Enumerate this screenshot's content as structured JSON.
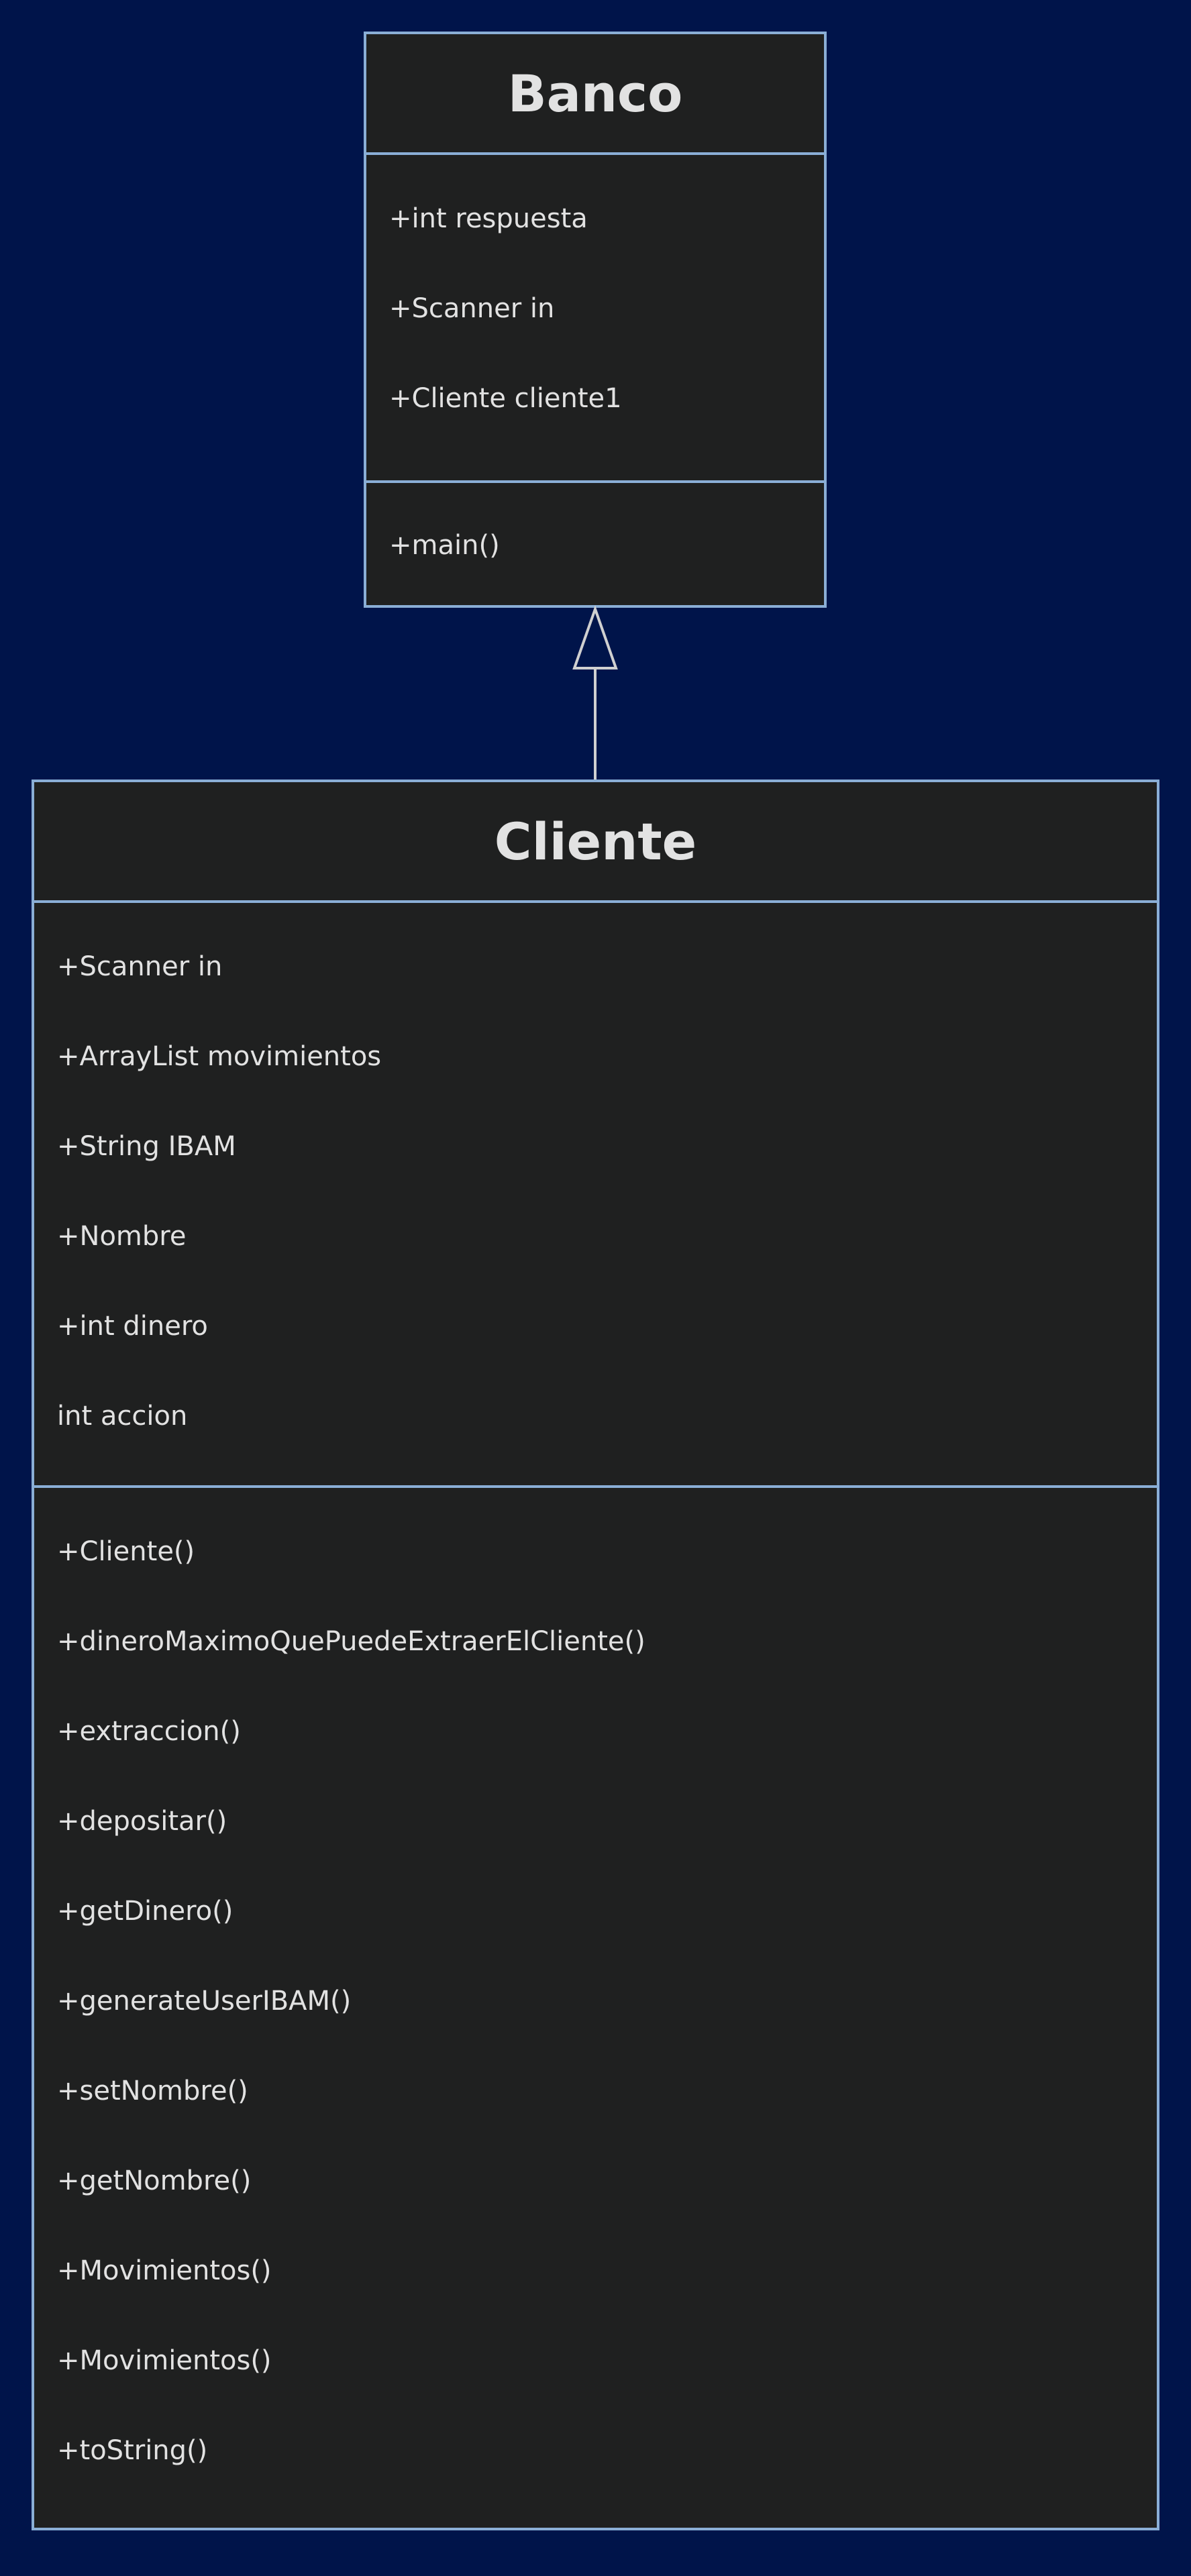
{
  "diagram": {
    "colors": {
      "background": "#00144a",
      "class_fill": "#1f2020",
      "class_border": "#8aaed6",
      "text": "#e2e2e2",
      "relation_line": "#d0d0d0"
    },
    "classes": [
      {
        "id": "banco",
        "name": "Banco",
        "attributes": [
          "+int respuesta",
          "+Scanner in",
          "+Cliente cliente1"
        ],
        "methods": [
          "+main()"
        ]
      },
      {
        "id": "cliente",
        "name": "Cliente",
        "attributes": [
          "+Scanner in",
          "+ArrayList movimientos",
          "+String IBAM",
          "+Nombre",
          "+int dinero",
          "int accion"
        ],
        "methods": [
          "+Cliente()",
          "+dineroMaximoQuePuedeExtraerElCliente()",
          "+extraccion()",
          "+depositar()",
          "+getDinero()",
          "+generateUserIBAM()",
          "+setNombre()",
          "+getNombre()",
          "+Movimientos()",
          "+Movimientos()",
          "+toString()"
        ]
      }
    ],
    "relations": [
      {
        "type": "inheritance",
        "from": "Cliente",
        "to": "Banco"
      }
    ]
  }
}
